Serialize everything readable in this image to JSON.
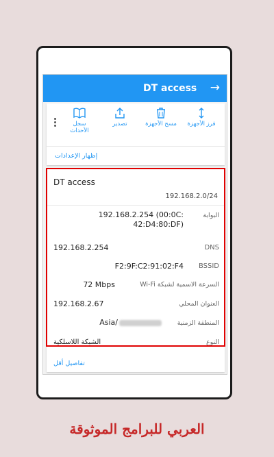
{
  "appbar": {
    "title": "DT access",
    "arrow_icon": "arrow-right-icon"
  },
  "toolbar": {
    "sort_label": "فرز الأجهزة",
    "clear_label": "مسح الأجهزة",
    "export_label": "تصدير",
    "history_label": "سجل الأحداث",
    "show_settings": "إظهار الإعدادات"
  },
  "network": {
    "ssid": "DT access",
    "subnet": "192.168.2.0/24",
    "gateway_label": "البوابة",
    "gateway_value_line1": "192.168.2.254 (00:0C:",
    "gateway_value_line2": "42:D4:80:DF)",
    "dns_label": "DNS",
    "dns_value": "192.168.2.254",
    "bssid_label": "BSSID",
    "bssid_value": "F2:9F:C2:91:02:F4",
    "speed_label": "السرعة الاسمية لشبكة Wi-Fi",
    "speed_value": "72 Mbps",
    "local_label": "العنوان المحلي",
    "local_value": "192.168.2.67",
    "tz_label": "المنطقة الزمنية",
    "tz_value": "Asia/",
    "type_label": "النوع",
    "type_value": "الشبكة اللاسلكية",
    "less_details": "تفاصيل أقل"
  },
  "brand": "العربي للبرامج الموثوقة",
  "colors": {
    "accent": "#2196f3",
    "highlight": "#e00000",
    "brand": "#c62828",
    "background": "#e8dcdc"
  }
}
